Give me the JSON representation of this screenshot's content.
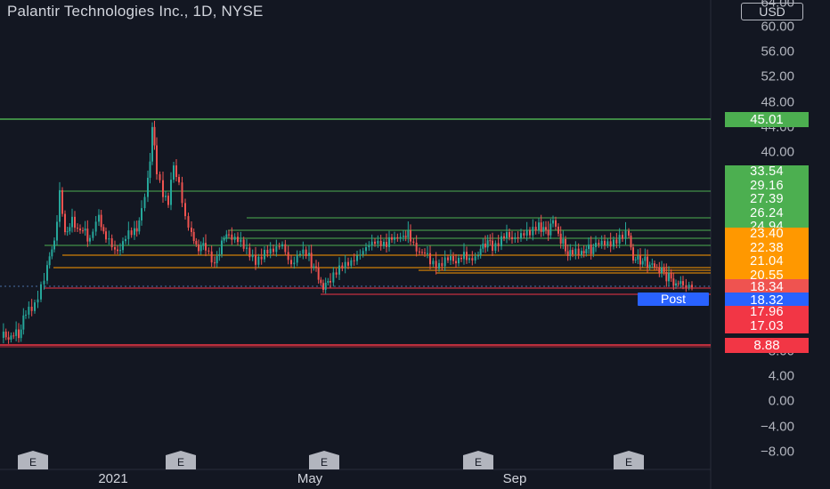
{
  "header": {
    "title": "Palantir Technologies Inc., 1D, NYSE"
  },
  "currency": "USD",
  "price_axis": {
    "ticks": [
      "64.00",
      "60.00",
      "56.00",
      "52.00",
      "48.00",
      "44.00",
      "40.00",
      "8.00",
      "4.00",
      "0.00",
      "−4.00",
      "−8.00"
    ]
  },
  "time_axis": {
    "labels": [
      "2021",
      "May",
      "Sep"
    ]
  },
  "post_label": "Post",
  "earnings_marker": "E",
  "price_badges": {
    "top": "45.01",
    "green_stack": [
      "33.54",
      "29.16",
      "27.39",
      "26.24",
      "24.94"
    ],
    "orange_stack": [
      "23.40",
      "22.38",
      "21.04",
      "20.55"
    ],
    "last": "18.34",
    "post": "18.32",
    "red_stack": [
      "17.96",
      "17.03"
    ],
    "bottom": "8.88"
  },
  "colors": {
    "background": "#131722",
    "up": "#26a69a",
    "down": "#ef5350",
    "green_level": "#4caf50",
    "orange_level": "#ff9800",
    "red_level": "#f23645",
    "post_blue": "#2962ff"
  },
  "chart_data": {
    "type": "candlestick",
    "title": "Palantir Technologies Inc., 1D, NYSE",
    "x_labels": [
      "2021",
      "May",
      "Sep"
    ],
    "y_ticks": [
      64,
      60,
      56,
      52,
      48,
      44,
      40,
      8,
      4,
      0,
      -4,
      -8
    ],
    "last_price": 18.34,
    "post_market_price": 18.32,
    "horizontal_levels": [
      45.01,
      33.54,
      29.16,
      27.39,
      26.24,
      24.94,
      23.4,
      22.38,
      21.04,
      20.55,
      17.96,
      17.03,
      8.88
    ],
    "approx_close_path": [
      {
        "period": "Dec 2020",
        "close": 10
      },
      {
        "period": "late Dec 2020",
        "close": 15
      },
      {
        "period": "early Jan 2021",
        "close": 22
      },
      {
        "period": "late Jan 2021",
        "close": 28
      },
      {
        "period": "early Feb 2021",
        "close": 34
      },
      {
        "period": "mid Feb 2021",
        "close": 28
      },
      {
        "period": "Mar 2021",
        "close": 23
      },
      {
        "period": "Apr 2021",
        "close": 23
      },
      {
        "period": "May 2021",
        "close": 19
      },
      {
        "period": "Jun 2021",
        "close": 25
      },
      {
        "period": "Jul 2021",
        "close": 22
      },
      {
        "period": "Aug 2021",
        "close": 24
      },
      {
        "period": "Sep 2021",
        "close": 27
      },
      {
        "period": "Oct 2021",
        "close": 24
      },
      {
        "period": "Nov 2021",
        "close": 21
      },
      {
        "period": "Dec 2021",
        "close": 18.3
      }
    ]
  }
}
